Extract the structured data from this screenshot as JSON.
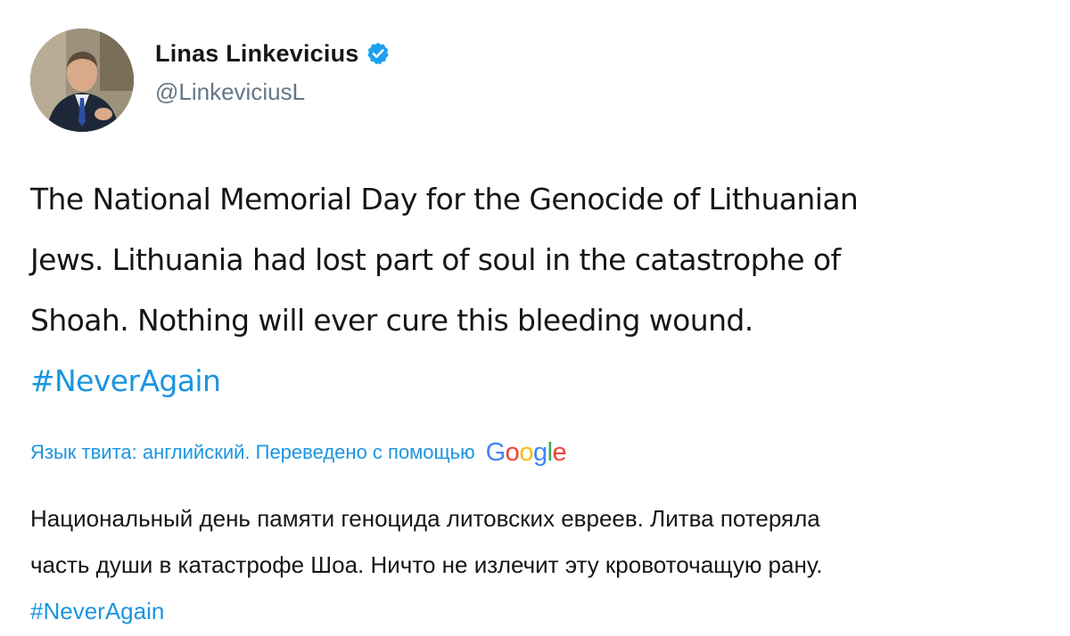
{
  "author": {
    "display_name": "Linas Linkevicius",
    "handle": "@LinkeviciusL",
    "verified_icon": "verified-badge-icon",
    "verified_color": "#1da1f2"
  },
  "tweet": {
    "lines": [
      "The National Memorial Day for the Genocide of Lithuanian",
      "Jews. Lithuania had lost part of soul in the catastrophe of",
      "Shoah. Nothing will ever cure this bleeding wound."
    ],
    "hashtag": "#NeverAgain"
  },
  "translation": {
    "note": "Язык твита: английский. Переведено с помощью",
    "provider_letters": [
      "G",
      "o",
      "o",
      "g",
      "l",
      "e"
    ],
    "provider_colors": [
      "#4285f4",
      "#ea4335",
      "#fbbc05",
      "#4285f4",
      "#34a853",
      "#ea4335"
    ],
    "lines": [
      "Национальный день памяти геноцида литовских евреев. Литва потеряла",
      "часть души в катастрофе Шоа. Ничто не излечит эту кровоточащую рану."
    ],
    "hashtag": "#NeverAgain"
  },
  "colors": {
    "link": "#1b95e0",
    "text": "#14171a",
    "muted": "#657786"
  }
}
